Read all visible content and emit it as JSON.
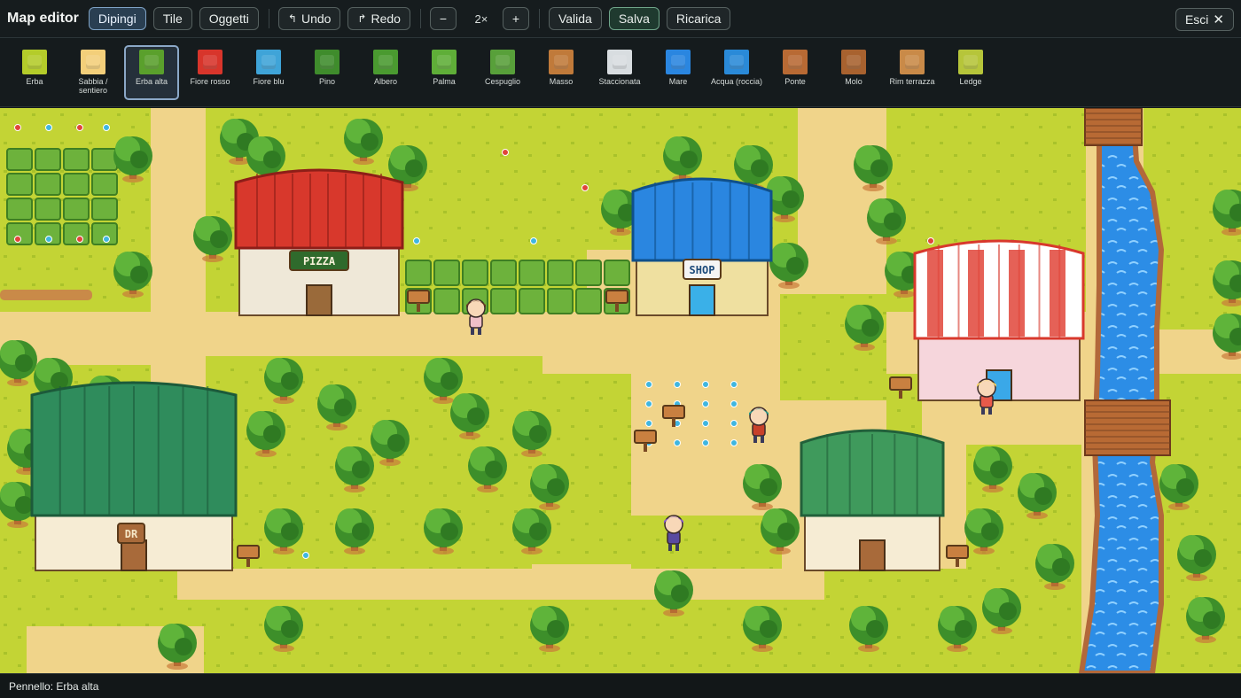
{
  "app": {
    "title": "Map editor"
  },
  "toolbar": {
    "modes": [
      {
        "label": "Dipingi",
        "active": true
      },
      {
        "label": "Tile",
        "active": false
      },
      {
        "label": "Oggetti",
        "active": false
      }
    ],
    "undo_label": "Undo",
    "redo_label": "Redo",
    "zoom_out_label": "−",
    "zoom_level": "2×",
    "zoom_in_label": "+",
    "validate_label": "Valida",
    "save_label": "Salva",
    "reload_label": "Ricarica",
    "exit_label": "Esci"
  },
  "palette": {
    "tiles": [
      {
        "label": "Erba",
        "icon": "grass-tile-icon",
        "color": "#b4cc2a"
      },
      {
        "label": "Sabbia / sentiero",
        "icon": "sand-path-tile-icon",
        "color": "#f3cf7a"
      },
      {
        "label": "Erba alta",
        "icon": "tall-grass-tile-icon",
        "color": "#5aa02c",
        "selected": true
      },
      {
        "label": "Fiore rosso",
        "icon": "red-flower-tile-icon",
        "color": "#d8352b"
      },
      {
        "label": "Fiore blu",
        "icon": "blue-flower-tile-icon",
        "color": "#3fa4d8"
      },
      {
        "label": "Pino",
        "icon": "pine-tile-icon",
        "color": "#3f8c2c"
      },
      {
        "label": "Albero",
        "icon": "tree-tile-icon",
        "color": "#4a9a30"
      },
      {
        "label": "Palma",
        "icon": "palm-tile-icon",
        "color": "#5fae38"
      },
      {
        "label": "Cespuglio",
        "icon": "bush-tile-icon",
        "color": "#58a03a"
      },
      {
        "label": "Masso",
        "icon": "boulder-tile-icon",
        "color": "#c07a3a"
      },
      {
        "label": "Staccionata",
        "icon": "fence-tile-icon",
        "color": "#d8dde0"
      },
      {
        "label": "Mare",
        "icon": "sea-tile-icon",
        "color": "#2a86e0"
      },
      {
        "label": "Acqua (roccia)",
        "icon": "rock-water-tile-icon",
        "color": "#2a8ad8"
      },
      {
        "label": "Ponte",
        "icon": "bridge-tile-icon",
        "color": "#b86a34"
      },
      {
        "label": "Molo",
        "icon": "pier-tile-icon",
        "color": "#a8622f"
      },
      {
        "label": "Rim terrazza",
        "icon": "terrace-rim-tile-icon",
        "color": "#c98a48"
      },
      {
        "label": "Ledge",
        "icon": "ledge-tile-icon",
        "color": "#b6c53a"
      }
    ]
  },
  "map": {
    "signs": {
      "pizza": "PIZZA",
      "shop": "SHOP",
      "lab": "DR"
    }
  },
  "status": {
    "text": "Pennello: Erba alta"
  },
  "colors": {
    "grass": "#c3d435",
    "sand": "#f0d48a",
    "tall_grass": "#6db23c",
    "water": "#2c8de6",
    "accent": "#8ba8c7"
  }
}
